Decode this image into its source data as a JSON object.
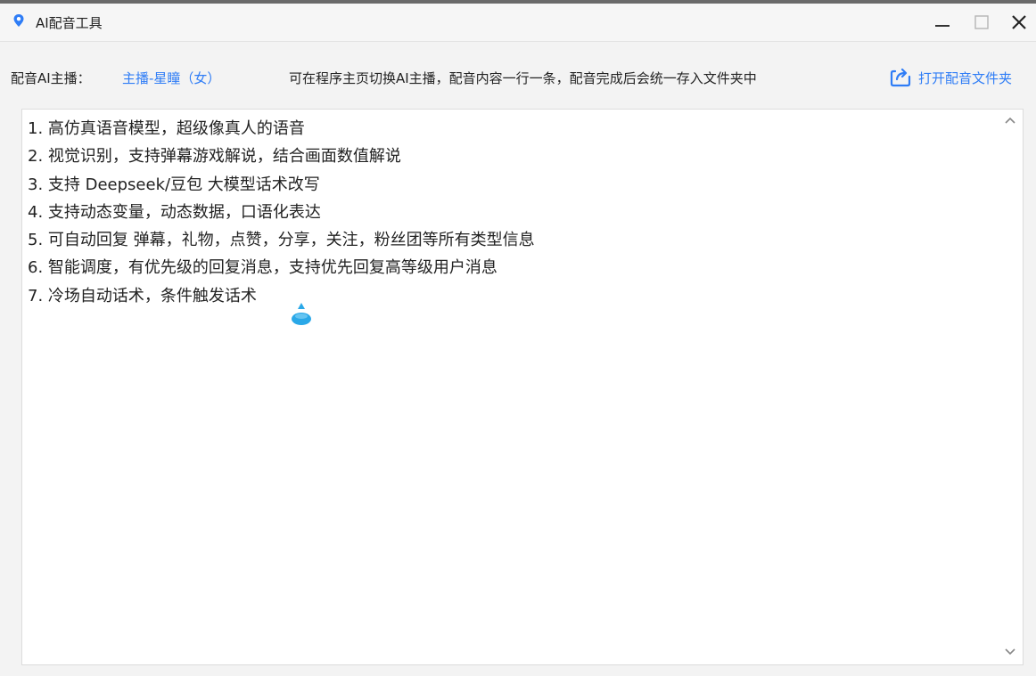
{
  "window": {
    "title": "AI配音工具",
    "controls": [
      "minimize",
      "maximize",
      "close"
    ],
    "icon": "location-pin-icon"
  },
  "toolbar": {
    "voice_label": "配音AI主播：",
    "voice_value": "主播-星瞳（女）",
    "hint": "可在程序主页切换AI主播，配音内容一行一条，配音完成后会统一存入文件夹中",
    "open_folder_label": "打开配音文件夹"
  },
  "editor": {
    "lines": [
      "1. 高仿真语音模型，超级像真人的语音",
      "2. 视觉识别，支持弹幕游戏解说，结合画面数值解说",
      "3. 支持 Deepseek/豆包 大模型话术改写",
      "4. 支持动态变量，动态数据，口语化表达",
      "5. 可自动回复 弹幕，礼物，点赞，分享，关注，粉丝团等所有类型信息",
      "6. 智能调度，有优先级的回复消息，支持优先回复高等级用户消息",
      "7. 冷场自动话术，条件触发话术"
    ]
  },
  "colors": {
    "accent": "#2f7df6",
    "text": "#222222",
    "background": "#f3f3f3",
    "editor_bg": "#ffffff"
  }
}
